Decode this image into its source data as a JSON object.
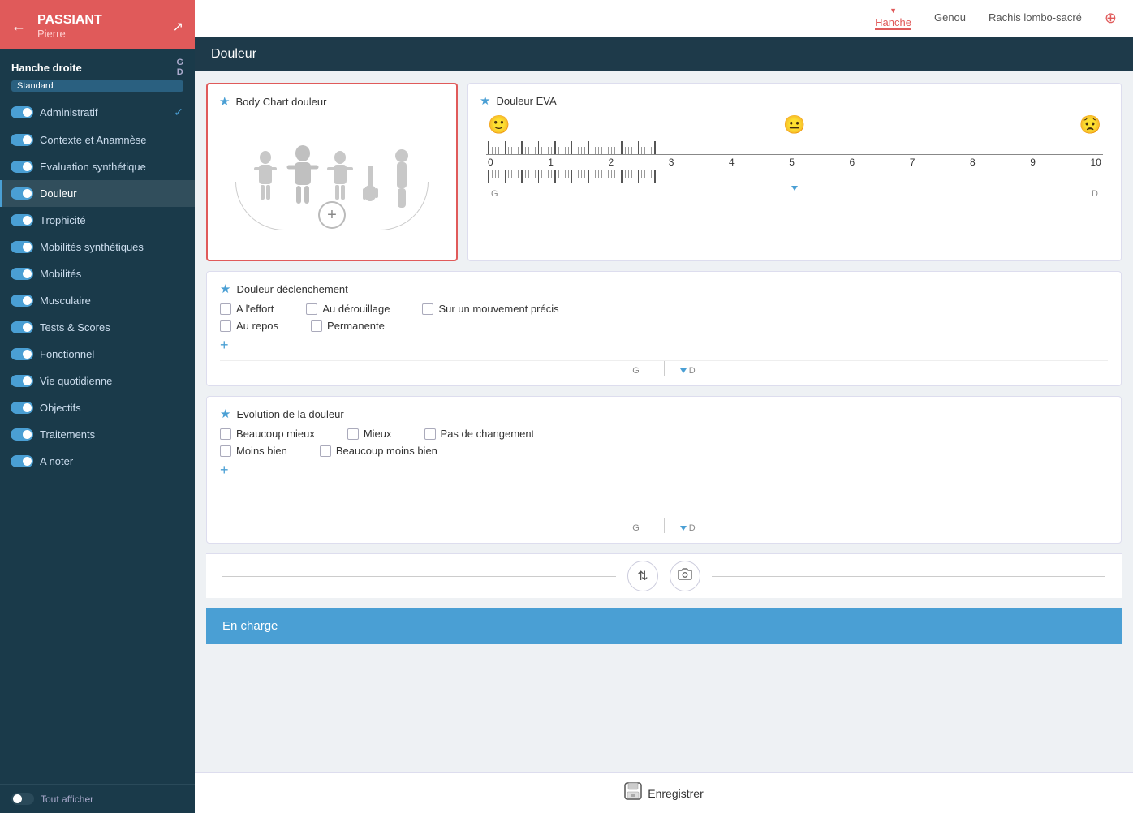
{
  "sidebar": {
    "patient_name": "PASSIANT",
    "patient_first": "Pierre",
    "section": "Hanche droite",
    "badge": "Standard",
    "items": [
      {
        "id": "administratif",
        "label": "Administratif",
        "toggle": true,
        "active": false,
        "checked": true
      },
      {
        "id": "contexte",
        "label": "Contexte et Anamnèse",
        "toggle": true,
        "active": false,
        "checked": false
      },
      {
        "id": "evaluation",
        "label": "Evaluation synthétique",
        "toggle": true,
        "active": false,
        "checked": false
      },
      {
        "id": "douleur",
        "label": "Douleur",
        "toggle": true,
        "active": true,
        "checked": false
      },
      {
        "id": "trophicite",
        "label": "Trophicité",
        "toggle": true,
        "active": false,
        "checked": false
      },
      {
        "id": "mobilites-syn",
        "label": "Mobilités synthétiques",
        "toggle": true,
        "active": false,
        "checked": false
      },
      {
        "id": "mobilites",
        "label": "Mobilités",
        "toggle": true,
        "active": false,
        "checked": false
      },
      {
        "id": "musculaire",
        "label": "Musculaire",
        "toggle": true,
        "active": false,
        "checked": false
      },
      {
        "id": "tests",
        "label": "Tests & Scores",
        "toggle": true,
        "active": false,
        "checked": false
      },
      {
        "id": "fonctionnel",
        "label": "Fonctionnel",
        "toggle": true,
        "active": false,
        "checked": false
      },
      {
        "id": "vie-quotidienne",
        "label": "Vie quotidienne",
        "toggle": true,
        "active": false,
        "checked": false
      },
      {
        "id": "objectifs",
        "label": "Objectifs",
        "toggle": true,
        "active": false,
        "checked": false
      },
      {
        "id": "traitements",
        "label": "Traitements",
        "toggle": true,
        "active": false,
        "checked": false
      },
      {
        "id": "a-noter",
        "label": "A noter",
        "toggle": true,
        "active": false,
        "checked": false
      }
    ],
    "footer_label": "Tout afficher"
  },
  "top_nav": {
    "items": [
      "Hanche",
      "Genou",
      "Rachis lombo-sacré"
    ],
    "active": "Hanche",
    "add_label": "+"
  },
  "header": {
    "title": "Douleur"
  },
  "body_chart": {
    "title": "Body Chart douleur",
    "add_label": "+"
  },
  "eva": {
    "title": "Douleur EVA",
    "numbers": [
      "0",
      "1",
      "2",
      "3",
      "4",
      "5",
      "6",
      "7",
      "8",
      "9",
      "10"
    ],
    "label_g": "G",
    "label_d": "D"
  },
  "declenchement": {
    "title": "Douleur déclenchement",
    "options_row1": [
      "A l'effort",
      "Au dérouillage",
      "Sur un mouvement précis"
    ],
    "options_row2": [
      "Au repos",
      "Permanente"
    ],
    "add_label": "+",
    "label_g": "G",
    "label_d": "D"
  },
  "evolution": {
    "title": "Evolution de la douleur",
    "options_row1": [
      "Beaucoup mieux",
      "Mieux",
      "Pas de changement"
    ],
    "options_row2": [
      "Moins bien",
      "Beaucoup moins bien"
    ],
    "add_label": "+",
    "label_g": "G",
    "label_d": "D"
  },
  "bottom_actions": {
    "scroll_icon": "⇅",
    "camera_icon": "📷"
  },
  "en_charge": {
    "label": "En charge"
  },
  "save": {
    "label": "Enregistrer",
    "icon": "💾"
  }
}
